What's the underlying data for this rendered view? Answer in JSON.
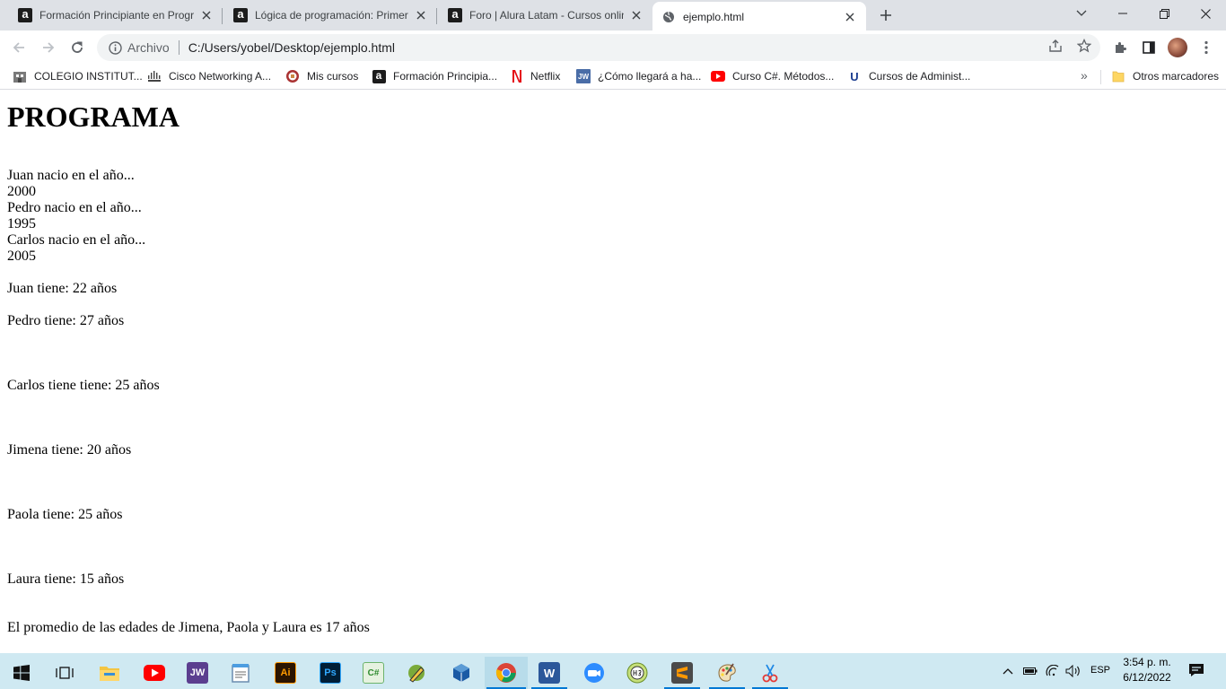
{
  "browser": {
    "tabs": [
      {
        "title": "Formación Principiante en Progra",
        "icon": "alura-icon",
        "active": false
      },
      {
        "title": "Lógica de programación: Primero",
        "icon": "alura-icon",
        "active": false
      },
      {
        "title": "Foro | Alura Latam - Cursos onlin",
        "icon": "alura-icon",
        "active": false
      },
      {
        "title": "ejemplo.html",
        "icon": "globe-icon",
        "active": true
      }
    ],
    "address_bar": {
      "security_label": "Archivo",
      "url": "C:/Users/yobel/Desktop/ejemplo.html"
    },
    "bookmarks": [
      {
        "label": "COLEGIO INSTITUT...",
        "icon": "school-icon"
      },
      {
        "label": "Cisco Networking A...",
        "icon": "cisco-icon"
      },
      {
        "label": "Mis cursos",
        "icon": "course-crest-icon"
      },
      {
        "label": "Formación Principia...",
        "icon": "alura-icon"
      },
      {
        "label": "Netflix",
        "icon": "netflix-icon"
      },
      {
        "label": "¿Cómo llegará a ha...",
        "icon": "jw-icon"
      },
      {
        "label": "Curso C#. Métodos...",
        "icon": "youtube-icon"
      },
      {
        "label": "Cursos de Administ...",
        "icon": "u-icon"
      }
    ],
    "bookmarks_overflow": "»",
    "other_bookmarks": "Otros marcadores"
  },
  "page": {
    "heading": "PROGRAMA",
    "lines": [
      "Juan nacio en el año...",
      "2000",
      "Pedro nacio en el año...",
      "1995",
      "Carlos nacio en el año...",
      "2005",
      "Juan tiene: 22 años",
      "Pedro tiene: 27 años",
      "Carlos tiene tiene: 25 años",
      "Jimena tiene: 20 años",
      "Paola tiene: 25 años",
      "Laura tiene: 15 años",
      "El promedio de las edades de Jimena, Paola y Laura es 17 años"
    ]
  },
  "taskbar": {
    "language": "ESP",
    "time": "3:54 p. m.",
    "date": "6/12/2022",
    "apps": [
      "start-icon",
      "task-view-icon",
      "file-explorer-icon",
      "youtube-app-icon",
      "jw-library-icon",
      "notepad-icon",
      "illustrator-icon",
      "photoshop-icon",
      "csharp-icon",
      "pencil-app-icon",
      "virtualbox-icon",
      "chrome-icon",
      "word-icon",
      "zoom-icon",
      "hs-icon",
      "sublime-text-icon",
      "paint-icon",
      "snipping-tool-icon"
    ]
  },
  "colors": {
    "tabstrip": "#dee1e6",
    "omnibox": "#f1f3f4",
    "taskbar": "#cfe9f2",
    "taskbar_active_underline": "#0078d4"
  }
}
